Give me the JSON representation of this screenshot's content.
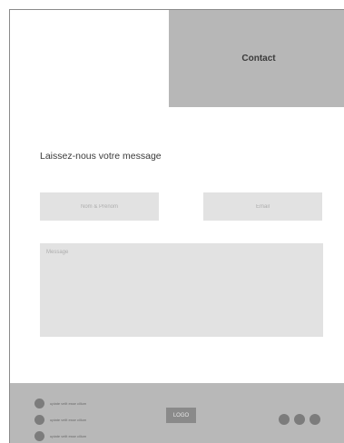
{
  "header": {
    "title": "Contact"
  },
  "form": {
    "title": "Laissez-nous votre message",
    "name_placeholder": "Nom & Prénom",
    "email_placeholder": "Email",
    "message_placeholder": "Message"
  },
  "footer": {
    "items": [
      {
        "label": "uptate velit esse cillum"
      },
      {
        "label": "uptate velit esse cillum"
      },
      {
        "label": "uptate velit esse cillum"
      }
    ],
    "logo": "LOGO",
    "social_icons": [
      "social-icon",
      "social-icon",
      "social-icon"
    ]
  },
  "colors": {
    "header_block": "#b7b7b7",
    "field_background": "#e2e2e2",
    "footer_background": "#b8b8b8",
    "icon_gray": "#7c7c7c"
  }
}
